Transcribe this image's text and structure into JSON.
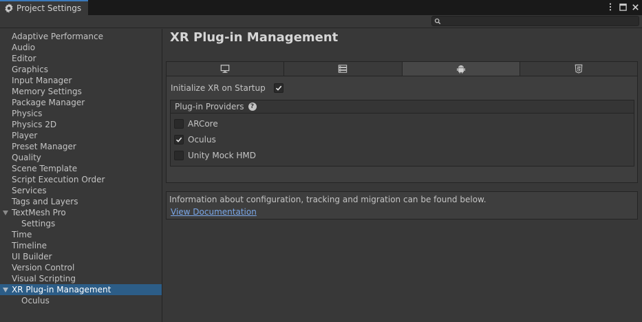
{
  "window": {
    "tab_title": "Project Settings"
  },
  "search": {
    "placeholder": "",
    "value": ""
  },
  "sidebar": {
    "items": [
      {
        "label": "Adaptive Performance"
      },
      {
        "label": "Audio"
      },
      {
        "label": "Editor"
      },
      {
        "label": "Graphics"
      },
      {
        "label": "Input Manager"
      },
      {
        "label": "Memory Settings"
      },
      {
        "label": "Package Manager"
      },
      {
        "label": "Physics"
      },
      {
        "label": "Physics 2D"
      },
      {
        "label": "Player"
      },
      {
        "label": "Preset Manager"
      },
      {
        "label": "Quality"
      },
      {
        "label": "Scene Template"
      },
      {
        "label": "Script Execution Order"
      },
      {
        "label": "Services"
      },
      {
        "label": "Tags and Layers"
      },
      {
        "label": "TextMesh Pro",
        "expanded": true
      },
      {
        "label": "Settings",
        "child": true
      },
      {
        "label": "Time"
      },
      {
        "label": "Timeline"
      },
      {
        "label": "UI Builder"
      },
      {
        "label": "Version Control"
      },
      {
        "label": "Visual Scripting"
      },
      {
        "label": "XR Plug-in Management",
        "expanded": true,
        "selected": true
      },
      {
        "label": "Oculus",
        "child": true
      }
    ]
  },
  "main": {
    "title": "XR Plug-in Management",
    "platform_tabs": [
      {
        "icon": "desktop-icon",
        "active": false
      },
      {
        "icon": "server-icon",
        "active": false
      },
      {
        "icon": "android-icon",
        "active": true
      },
      {
        "icon": "html5-icon",
        "active": false
      }
    ],
    "init_label": "Initialize XR on Startup",
    "init_checked": true,
    "providers_header": "Plug-in Providers",
    "providers": [
      {
        "label": "ARCore",
        "checked": false
      },
      {
        "label": "Oculus",
        "checked": true
      },
      {
        "label": "Unity Mock HMD",
        "checked": false
      }
    ],
    "info_text": "Information about configuration, tracking and migration can be found below.",
    "doc_link": "View Documentation"
  },
  "colors": {
    "accent": "#3a79bb",
    "selected_bg": "#2c5d87",
    "link": "#7aa7e8"
  }
}
